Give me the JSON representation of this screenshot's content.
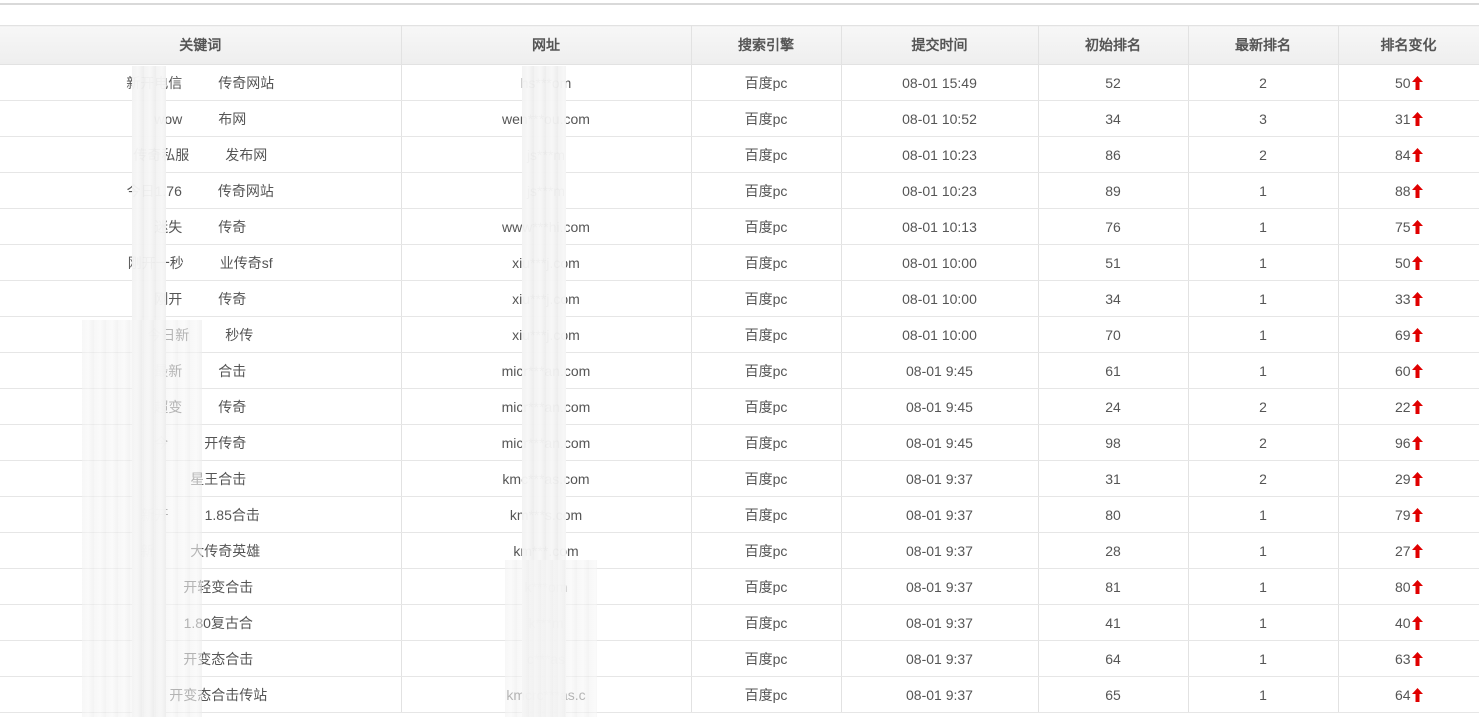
{
  "table": {
    "headers": [
      "关键词",
      "网址",
      "搜索引擎",
      "提交时间",
      "初始排名",
      "最新排名",
      "排名变化"
    ],
    "rows": [
      {
        "keyword": "新开电信",
        "keyword_tail": "传奇网站",
        "url": "hs***om",
        "engine": "百度pc",
        "time": "08-01 15:49",
        "initial": "52",
        "latest": "2",
        "change": "50"
      },
      {
        "keyword": "wow",
        "keyword_tail": "布网",
        "url": "wen***ou.com",
        "engine": "百度pc",
        "time": "08-01 10:52",
        "initial": "34",
        "latest": "3",
        "change": "31"
      },
      {
        "keyword": "传奇私服",
        "keyword_tail": "发布网",
        "url": "js***m",
        "engine": "百度pc",
        "time": "08-01 10:23",
        "initial": "86",
        "latest": "2",
        "change": "84"
      },
      {
        "keyword": "今日1.76",
        "keyword_tail": "传奇网站",
        "url": "js***m",
        "engine": "百度pc",
        "time": "08-01 10:23",
        "initial": "89",
        "latest": "1",
        "change": "88"
      },
      {
        "keyword": "迷失",
        "keyword_tail": "传奇",
        "url": "www***hi.com",
        "engine": "百度pc",
        "time": "08-01 10:13",
        "initial": "76",
        "latest": "1",
        "change": "75"
      },
      {
        "keyword": "刚开一秒",
        "keyword_tail": "业传奇sf",
        "url": "xiu***j.com",
        "engine": "百度pc",
        "time": "08-01 10:00",
        "initial": "51",
        "latest": "1",
        "change": "50"
      },
      {
        "keyword": "刚开",
        "keyword_tail": "传奇",
        "url": "xiu***j.com",
        "engine": "百度pc",
        "time": "08-01 10:00",
        "initial": "34",
        "latest": "1",
        "change": "33"
      },
      {
        "keyword": "今日新",
        "keyword_tail": "秒传",
        "url": "xiu***j.com",
        "engine": "百度pc",
        "time": "08-01 10:00",
        "initial": "70",
        "latest": "1",
        "change": "69"
      },
      {
        "keyword": "最新",
        "keyword_tail": "合击",
        "url": "micr***an.com",
        "engine": "百度pc",
        "time": "08-01 9:45",
        "initial": "61",
        "latest": "1",
        "change": "60"
      },
      {
        "keyword": "超变",
        "keyword_tail": "传奇",
        "url": "micr***an.com",
        "engine": "百度pc",
        "time": "08-01 9:45",
        "initial": "24",
        "latest": "2",
        "change": "22"
      },
      {
        "keyword": "今",
        "keyword_tail": "开传奇",
        "url": "micr***an.com",
        "engine": "百度pc",
        "time": "08-01 9:45",
        "initial": "98",
        "latest": "2",
        "change": "96"
      },
      {
        "keyword": "",
        "keyword_tail": "星王合击",
        "url": "kmc***as.com",
        "engine": "百度pc",
        "time": "08-01 9:37",
        "initial": "31",
        "latest": "2",
        "change": "29"
      },
      {
        "keyword": "新开",
        "keyword_tail": "1.85合击",
        "url": "km***s.com",
        "engine": "百度pc",
        "time": "08-01 9:37",
        "initial": "80",
        "latest": "1",
        "change": "79"
      },
      {
        "keyword": "新",
        "keyword_tail": "大传奇英雄",
        "url": "km***.com",
        "engine": "百度pc",
        "time": "08-01 9:37",
        "initial": "28",
        "latest": "1",
        "change": "27"
      },
      {
        "keyword": "",
        "keyword_tail": "开轻变合击",
        "url": "k***om",
        "engine": "百度pc",
        "time": "08-01 9:37",
        "initial": "81",
        "latest": "1",
        "change": "80"
      },
      {
        "keyword": "",
        "keyword_tail": "1.80复古合",
        "url": "k***m",
        "engine": "百度pc",
        "time": "08-01 9:37",
        "initial": "41",
        "latest": "1",
        "change": "40"
      },
      {
        "keyword": "",
        "keyword_tail": "开变态合击",
        "url": "c***as",
        "engine": "百度pc",
        "time": "08-01 9:37",
        "initial": "64",
        "latest": "1",
        "change": "63"
      },
      {
        "keyword": "",
        "keyword_tail": "开变态合击传站",
        "url": "kmcrc***as.c",
        "engine": "百度pc",
        "time": "08-01 9:37",
        "initial": "65",
        "latest": "1",
        "change": "64"
      }
    ]
  },
  "colors": {
    "arrow_up": "#e00000",
    "header_bg": "#f2f2f2",
    "text": "#555555",
    "grid": "#e2e2e2"
  },
  "icons": {
    "change_indicator": "up-arrow-icon"
  }
}
